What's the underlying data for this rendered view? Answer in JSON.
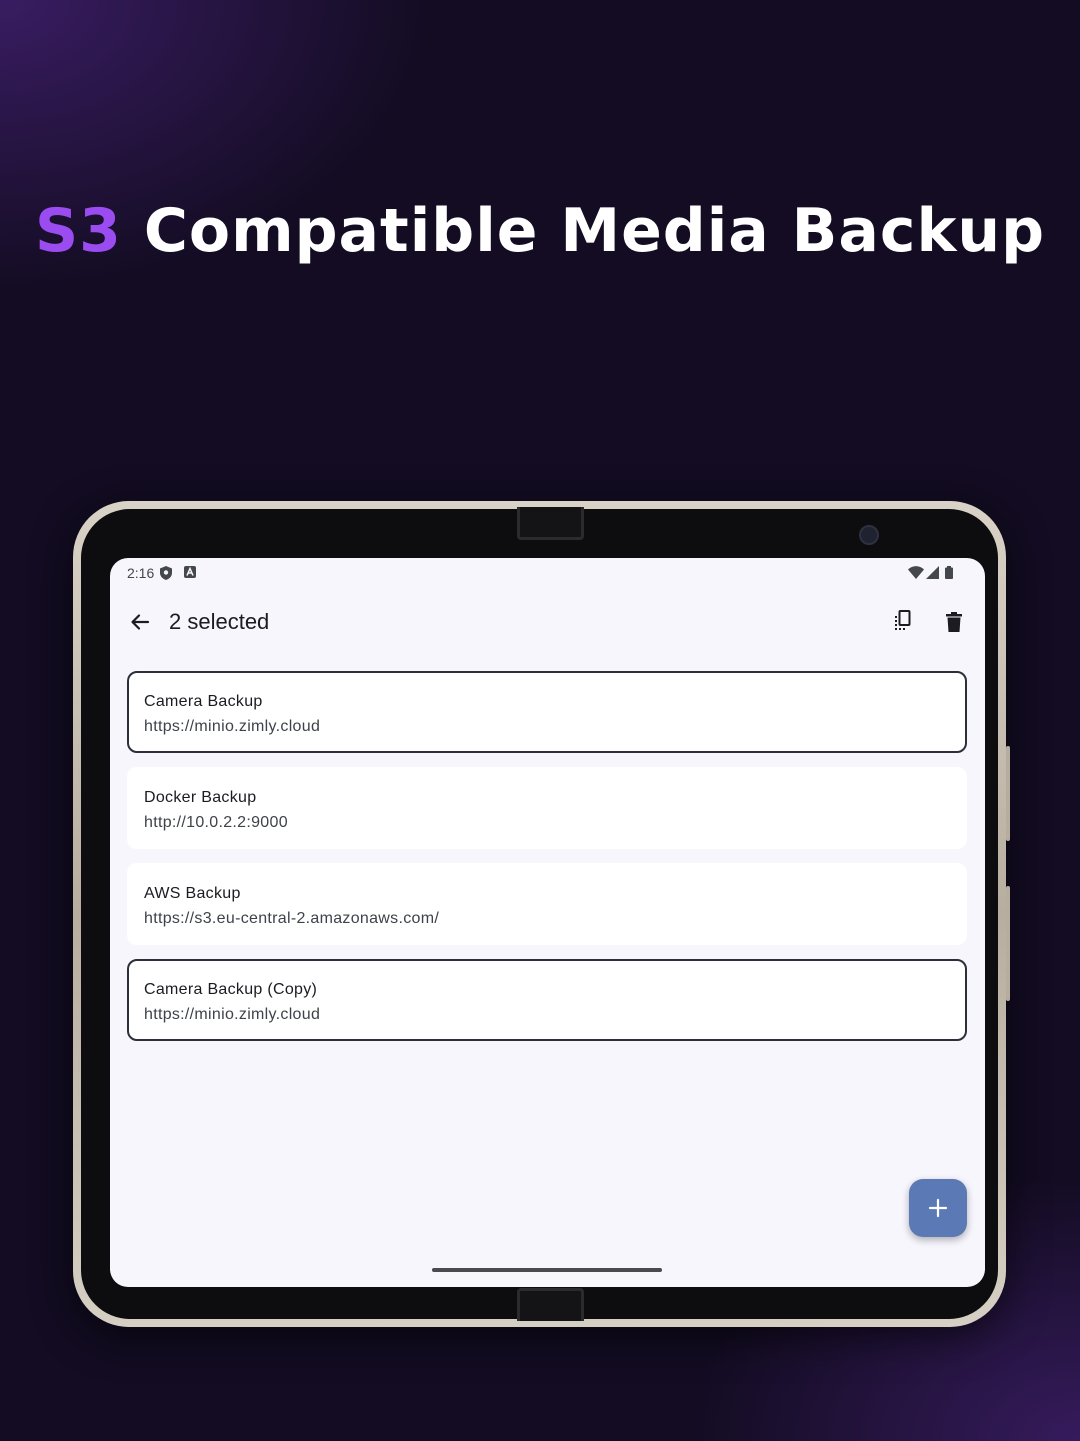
{
  "headline": {
    "accent": "S3",
    "rest": "Compatible Media Backup"
  },
  "status_bar": {
    "time": "2:16"
  },
  "app_bar": {
    "title": "2 selected"
  },
  "backups": [
    {
      "name": "Camera Backup",
      "url": "https://minio.zimly.cloud",
      "selected": true
    },
    {
      "name": "Docker Backup",
      "url": "http://10.0.2.2:9000",
      "selected": false
    },
    {
      "name": "AWS Backup",
      "url": "https://s3.eu-central-2.amazonaws.com/",
      "selected": false
    },
    {
      "name": "Camera Backup (Copy)",
      "url": "https://minio.zimly.cloud",
      "selected": true
    }
  ],
  "icons": {
    "back": "arrow-back-icon",
    "copy": "copy-icon",
    "delete": "delete-icon",
    "fab": "add-icon"
  },
  "colors": {
    "accent": "#9b4cf0",
    "fab": "#5b7ab5",
    "background": "#130c22",
    "screen": "#f7f6fd"
  }
}
